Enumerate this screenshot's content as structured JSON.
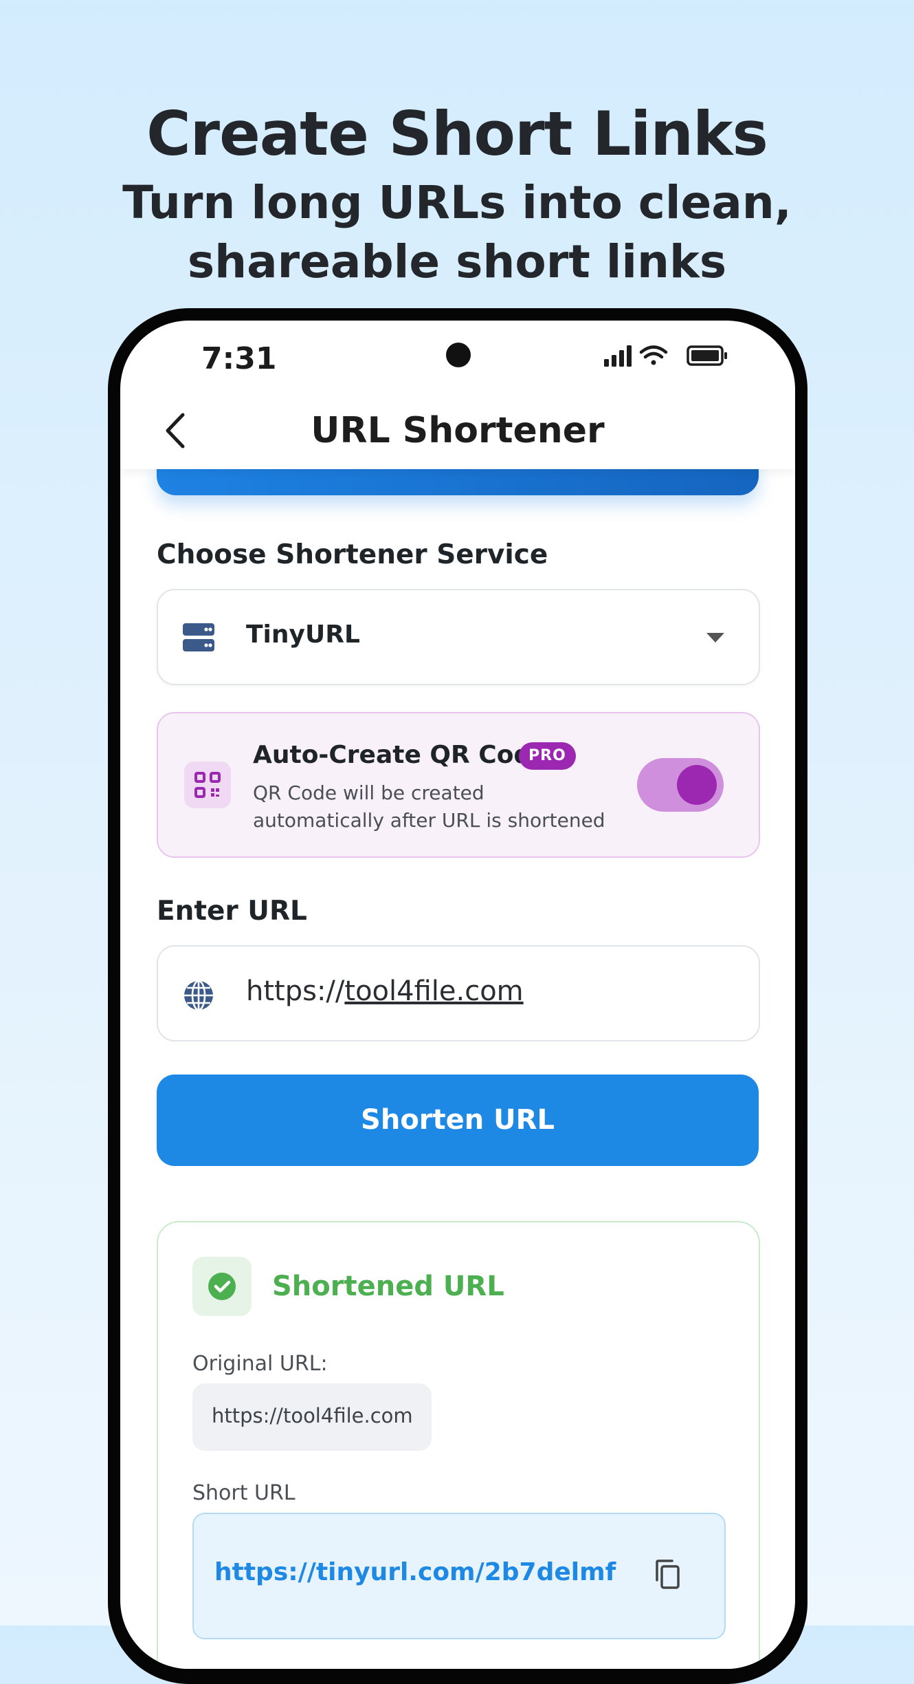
{
  "hero": {
    "title": "Create Short Links",
    "subtitle_line1": "Turn long URLs into clean,",
    "subtitle_line2": "shareable short links"
  },
  "status_bar": {
    "time": "7:31",
    "icons": [
      "signal-icon",
      "wifi-icon",
      "battery-icon"
    ]
  },
  "app_bar": {
    "title": "URL Shortener",
    "back_icon": "chevron-left-icon"
  },
  "service": {
    "label": "Choose Shortener Service",
    "selected": "TinyURL",
    "icon": "server-icon"
  },
  "qr_option": {
    "title": "Auto-Create QR Code",
    "badge": "PRO",
    "description": "QR Code will be created automatically after URL is shortened",
    "enabled": true,
    "icon": "qr-code-icon"
  },
  "url_input": {
    "label": "Enter URL",
    "value_prefix": "https://",
    "value_link": "tool4file.com",
    "icon": "globe-icon"
  },
  "shorten_button": {
    "label": "Shorten URL"
  },
  "result": {
    "title": "Shortened URL",
    "original_label": "Original URL:",
    "original_value": "https://tool4file.com",
    "short_label": "Short URL",
    "short_value": "https://tinyurl.com/2b7delmf",
    "icons": [
      "check-circle-icon",
      "copy-icon"
    ]
  },
  "colors": {
    "primary": "#1e88e5",
    "pro_purple": "#9c27b0",
    "success_green": "#4caf50",
    "background": "#d3ecfd"
  }
}
